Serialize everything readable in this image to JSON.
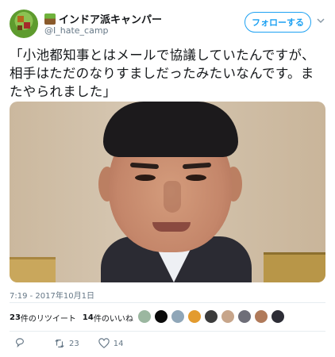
{
  "user": {
    "display_name": "インドア派キャンパー",
    "handle": "@I_hate_camp",
    "follow_label": "フォローする"
  },
  "tweet": {
    "text": "「小池都知事とはメールで協議していたんですが、相手はただのなりすましだったみたいなんです。またやられました」",
    "timestamp": "7:19 - 2017年10月1日"
  },
  "stats": {
    "retweets_count": "23",
    "retweets_label": "件のリツイート",
    "likes_count": "14",
    "likes_label": "件のいいね"
  },
  "actions": {
    "retweet_count": "23",
    "like_count": "14"
  },
  "colors": {
    "accent": "#1da1f2",
    "secondary_text": "#657786",
    "divider": "#e6ecf0"
  },
  "likers": [
    {
      "color": "#9bb7a0"
    },
    {
      "color": "#0b0b0b"
    },
    {
      "color": "#8fa6b8"
    },
    {
      "color": "#e39b2f"
    },
    {
      "color": "#3c3c3c"
    },
    {
      "color": "#c7a58a"
    },
    {
      "color": "#6e6e78"
    },
    {
      "color": "#b07a5a"
    },
    {
      "color": "#2d2d36"
    }
  ]
}
